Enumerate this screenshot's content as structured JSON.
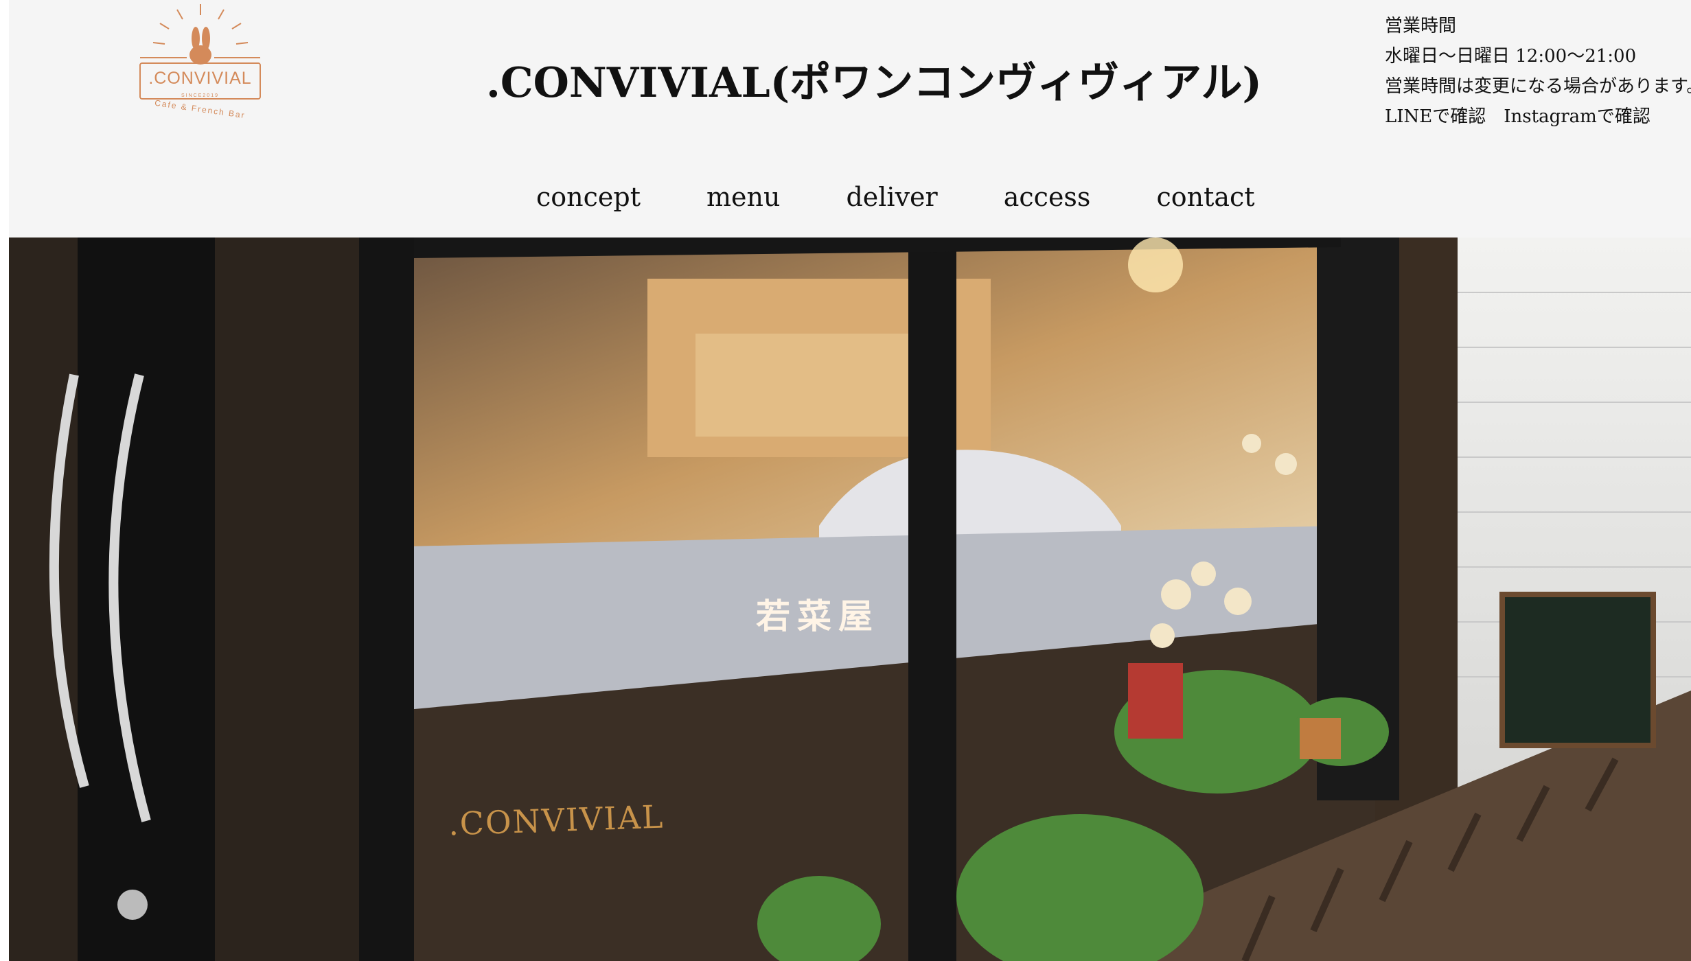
{
  "header": {
    "logo": {
      "name": ".CONVIVIAL",
      "since": "SINCE2019",
      "sub": "Cafe & French Bar",
      "icon": "rabbit-icon"
    },
    "title": ".CONVIVIAL(ポワンコンヴィヴィアル)",
    "hours": {
      "label": "営業時間",
      "days": "水曜日〜日曜日 12:00〜21:00",
      "note": "営業時間は変更になる場合があります。",
      "links": [
        "LINEで確認",
        "Instagramで確認"
      ]
    }
  },
  "nav": [
    "concept",
    "menu",
    "deliver",
    "access",
    "contact"
  ],
  "hero": {
    "window_sign": ".CONVIVIAL",
    "street_shop": "若菜屋"
  },
  "colors": {
    "brand": "#d48a5a",
    "header_bg": "#f5f5f5",
    "text": "#111111"
  }
}
